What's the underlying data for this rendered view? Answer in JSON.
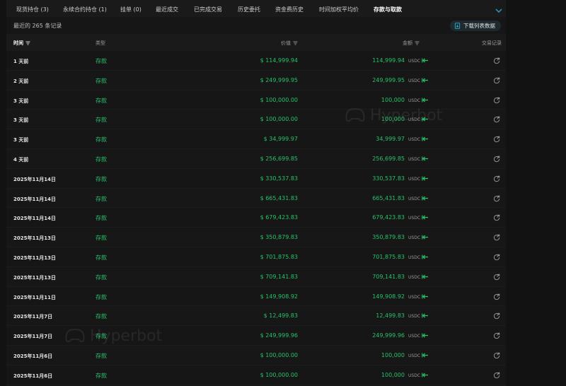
{
  "tabs": [
    {
      "label": "现货持仓 (3)",
      "active": false
    },
    {
      "label": "永续合约持仓 (1)",
      "active": false
    },
    {
      "label": "挂单 (0)",
      "active": false
    },
    {
      "label": "最近成交",
      "active": false
    },
    {
      "label": "已完成交易",
      "active": false
    },
    {
      "label": "历史委托",
      "active": false
    },
    {
      "label": "资金费历史",
      "active": false
    },
    {
      "label": "时间加权平均价",
      "active": false
    },
    {
      "label": "存款与取款",
      "active": true
    }
  ],
  "subbar": {
    "record_count": "最近的 265 条记录",
    "download_label": "下载列表数据"
  },
  "table": {
    "headers": {
      "time": "时间",
      "type": "类型",
      "price": "价值",
      "amount": "金额",
      "tx": "交易记录"
    },
    "rows": [
      {
        "time": "1 天前",
        "type": "存款",
        "price": "$ 114,999.94",
        "amount": "114,999.94",
        "unit": "USDC"
      },
      {
        "time": "2 天前",
        "type": "存款",
        "price": "$ 249,999.95",
        "amount": "249,999.95",
        "unit": "USDC"
      },
      {
        "time": "3 天前",
        "type": "存款",
        "price": "$ 100,000.00",
        "amount": "100,000",
        "unit": "USDC"
      },
      {
        "time": "3 天前",
        "type": "存款",
        "price": "$ 100,000.00",
        "amount": "100,000",
        "unit": "USDC"
      },
      {
        "time": "3 天前",
        "type": "存款",
        "price": "$ 34,999.97",
        "amount": "34,999.97",
        "unit": "USDC"
      },
      {
        "time": "4 天前",
        "type": "存款",
        "price": "$ 256,699.85",
        "amount": "256,699.85",
        "unit": "USDC"
      },
      {
        "time": "2025年11月14日",
        "type": "存款",
        "price": "$ 330,537.83",
        "amount": "330,537.83",
        "unit": "USDC"
      },
      {
        "time": "2025年11月14日",
        "type": "存款",
        "price": "$ 665,431.83",
        "amount": "665,431.83",
        "unit": "USDC"
      },
      {
        "time": "2025年11月14日",
        "type": "存款",
        "price": "$ 679,423.83",
        "amount": "679,423.83",
        "unit": "USDC"
      },
      {
        "time": "2025年11月13日",
        "type": "存款",
        "price": "$ 350,879.83",
        "amount": "350,879.83",
        "unit": "USDC"
      },
      {
        "time": "2025年11月13日",
        "type": "存款",
        "price": "$ 701,875.83",
        "amount": "701,875.83",
        "unit": "USDC"
      },
      {
        "time": "2025年11月13日",
        "type": "存款",
        "price": "$ 709,141.83",
        "amount": "709,141.83",
        "unit": "USDC"
      },
      {
        "time": "2025年11月11日",
        "type": "存款",
        "price": "$ 149,908.92",
        "amount": "149,908.92",
        "unit": "USDC"
      },
      {
        "time": "2025年11月7日",
        "type": "存款",
        "price": "$ 12,499.83",
        "amount": "12,499.83",
        "unit": "USDC"
      },
      {
        "time": "2025年11月7日",
        "type": "存款",
        "price": "$ 249,999.96",
        "amount": "249,999.96",
        "unit": "USDC"
      },
      {
        "time": "2025年11月6日",
        "type": "存款",
        "price": "$ 100,000.00",
        "amount": "100,000",
        "unit": "USDC"
      },
      {
        "time": "2025年11月6日",
        "type": "存款",
        "price": "$ 100,000.00",
        "amount": "100,000",
        "unit": "USDC"
      }
    ]
  },
  "watermark": "Hyperbot",
  "colors": {
    "accent_green": "#27c26a",
    "background": "#121212",
    "panel": "#161616"
  },
  "icons": {
    "tabs_chevron": "chevron-down-icon",
    "download": "file-download-icon",
    "sort": "filter-icon",
    "direction": "arrow-left-icon",
    "tx_link": "external-link-icon"
  }
}
